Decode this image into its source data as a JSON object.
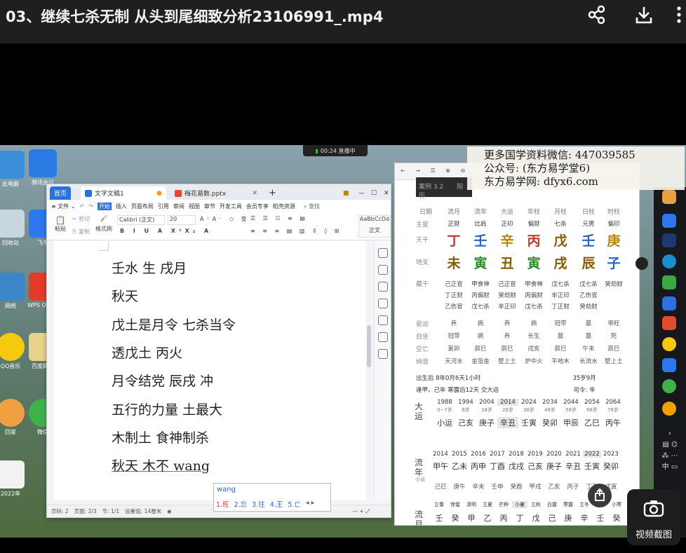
{
  "video": {
    "title": "03、继续七杀无制 从头到尾细致分析23106991_.mp4",
    "share_icon": "share-icon",
    "download_icon": "download-icon",
    "more_icon": "more-vertical-icon"
  },
  "recorder": {
    "badge": "00:24 直播中"
  },
  "desktop_icons": [
    {
      "label": "此电脑",
      "color": "#3a8fd8"
    },
    {
      "label": "腾讯会议",
      "color": "#2a7be4"
    },
    {
      "label": "回收站",
      "color": "#c8d6e0"
    },
    {
      "label": "飞书",
      "color": "#2d77f0"
    },
    {
      "label": "网络",
      "color": "#3b86c8"
    },
    {
      "label": "WPS Office",
      "color": "#e53a2a"
    },
    {
      "label": "QQ音乐",
      "color": "#f6c90e"
    },
    {
      "label": "百度网盘",
      "color": "#e8d28a"
    },
    {
      "label": "回家",
      "color": "#f0a040"
    },
    {
      "label": "微信",
      "color": "#3fb24a"
    },
    {
      "label": "2022年",
      "color": "#f2f2f2"
    }
  ],
  "wps": {
    "tab_home": "首页",
    "tab_doc": "文字文稿1",
    "tab_ppt": "梅花易数.pptx",
    "menu_file": "文件",
    "menus": [
      "开始",
      "插入",
      "页面布局",
      "引用",
      "审阅",
      "视图",
      "章节",
      "开发工具",
      "会员专享",
      "稻壳资源"
    ],
    "search": "查找",
    "font_name": "Calibri (正文)",
    "font_size": "20",
    "style_preview": "AaBbCcDd",
    "style_label": "正文",
    "clip_paste": "粘贴",
    "clip_cut": "剪切",
    "clip_copy": "复制",
    "clip_format": "格式刷",
    "doc_lines": [
      "壬水  生  戌月",
      "秋天",
      "戊土是月令  七杀当令",
      "透戊土  丙火",
      "月令结党  辰戌  冲",
      "五行的力量  土最大",
      "木制土  食神制杀",
      "秋天  木不 wang"
    ],
    "status_page": "页码: 2",
    "status_pages": "页面: 2/3",
    "status_section": "节: 1/1",
    "status_setting": "设置值: 14厘米"
  },
  "ime": {
    "pinyin": "wang",
    "candidates": [
      "1.旺",
      "2.忘",
      "3.往",
      "4.王",
      "5.亡"
    ]
  },
  "bazi": {
    "header_label": "案例 3.2",
    "header_sub": "阳历",
    "col_heads": [
      "日期",
      "流月",
      "流年",
      "大运",
      "年柱",
      "月柱",
      "日柱",
      "时柱"
    ],
    "zhuxing_label": "主星",
    "zhuxing": [
      "正财",
      "比肩",
      "正印",
      "偏财",
      "七杀",
      "元男",
      "偏印"
    ],
    "tiangan_label": "天干",
    "tiangan": [
      {
        "t": "丁",
        "c": "#c0392b"
      },
      {
        "t": "壬",
        "c": "#2a64c8"
      },
      {
        "t": "辛",
        "c": "#b8860b"
      },
      {
        "t": "丙",
        "c": "#c0392b"
      },
      {
        "t": "戊",
        "c": "#8b5a00"
      },
      {
        "t": "壬",
        "c": "#2a64c8"
      },
      {
        "t": "庚",
        "c": "#b8860b"
      }
    ],
    "dizhi_label": "地支",
    "dizhi": [
      {
        "t": "未",
        "c": "#8b5a00"
      },
      {
        "t": "寅",
        "c": "#2e8b2e"
      },
      {
        "t": "丑",
        "c": "#8b5a00"
      },
      {
        "t": "寅",
        "c": "#2e8b2e"
      },
      {
        "t": "戌",
        "c": "#8b5a00"
      },
      {
        "t": "辰",
        "c": "#8b5a00"
      },
      {
        "t": "子",
        "c": "#2a64c8"
      }
    ],
    "canggan_label": "藏干",
    "canggan": [
      [
        "己正官",
        "丁正财",
        "乙伤官"
      ],
      [
        "甲食神",
        "丙偏财",
        "戊七杀"
      ],
      [
        "己正官",
        "癸劫财",
        "辛正印"
      ],
      [
        "甲食神",
        "丙偏财",
        "戊七杀"
      ],
      [
        "戊七杀",
        "辛正印",
        "丁正财"
      ],
      [
        "戊七杀",
        "乙伤官",
        "癸劫财"
      ],
      [
        "癸劫财",
        "",
        ""
      ]
    ],
    "xingyun_label": "星运",
    "xingyun": [
      "养",
      "病",
      "养",
      "病",
      "冠带",
      "墓",
      "帝旺"
    ],
    "zizuo_label": "自坐",
    "zizuo": [
      "冠带",
      "病",
      "养",
      "长生",
      "墓",
      "墓",
      "死"
    ],
    "kongwang_label": "空亡",
    "kongwang": [
      "寅卯",
      "辰巳",
      "辰巳",
      "戌亥",
      "辰巳",
      "午未",
      "辰巳"
    ],
    "nayin_label": "纳音",
    "nayin": [
      "天河水",
      "金箔金",
      "壁上土",
      "炉中火",
      "平地木",
      "长流水",
      "壁上土"
    ],
    "birth": "出生后 8年0月6天1小时",
    "age": "35岁9月",
    "qiyun": "逢甲、己年 寒露后12天 交大运",
    "siling": "司令: 辛",
    "dayun_label": "大运",
    "dayun_years": [
      "1988",
      "1994",
      "2004",
      "2014",
      "2024",
      "2034",
      "2044",
      "2054",
      "2064"
    ],
    "dayun_ages": [
      "0~7岁",
      "8岁",
      "18岁",
      "28岁",
      "38岁",
      "48岁",
      "58岁",
      "68岁",
      "78岁"
    ],
    "dayun_gz": [
      "小运",
      "己亥",
      "庚子",
      "辛丑",
      "壬寅",
      "癸卯",
      "甲辰",
      "乙巳",
      "丙午"
    ],
    "liunian_label": "流年",
    "liunian_years": [
      "2014",
      "2015",
      "2016",
      "2017",
      "2018",
      "2019",
      "2020",
      "2021",
      "2022",
      "2023"
    ],
    "liunian_gz": [
      "甲午",
      "乙未",
      "丙申",
      "丁酉",
      "戊戌",
      "己亥",
      "庚子",
      "辛丑",
      "壬寅",
      "癸卯"
    ],
    "xiaoyun_label": "小运",
    "xiaoyun": [
      "己巳",
      "庚午",
      "辛未",
      "壬申",
      "癸酉",
      "甲戌",
      "乙亥",
      "丙子",
      "丁丑",
      "戊寅"
    ],
    "liuyue_label": "流月",
    "jieqi": [
      "立春",
      "惊蛰",
      "清明",
      "立夏",
      "芒种",
      "小暑",
      "立秋",
      "白露",
      "寒露",
      "立冬",
      "大雪",
      "小寒"
    ],
    "liuyue_tg": [
      "壬",
      "癸",
      "甲",
      "乙",
      "丙",
      "丁",
      "戊",
      "己",
      "庚",
      "辛",
      "壬",
      "癸"
    ]
  },
  "watermark": {
    "line1": "更多国学资料微信: 447039585",
    "line2": "公众号: (东方易学堂6)",
    "line3": "东方易学网: dfyx6.com"
  },
  "screenshot_button": {
    "label": "视频截图",
    "icon": "camera-icon"
  }
}
